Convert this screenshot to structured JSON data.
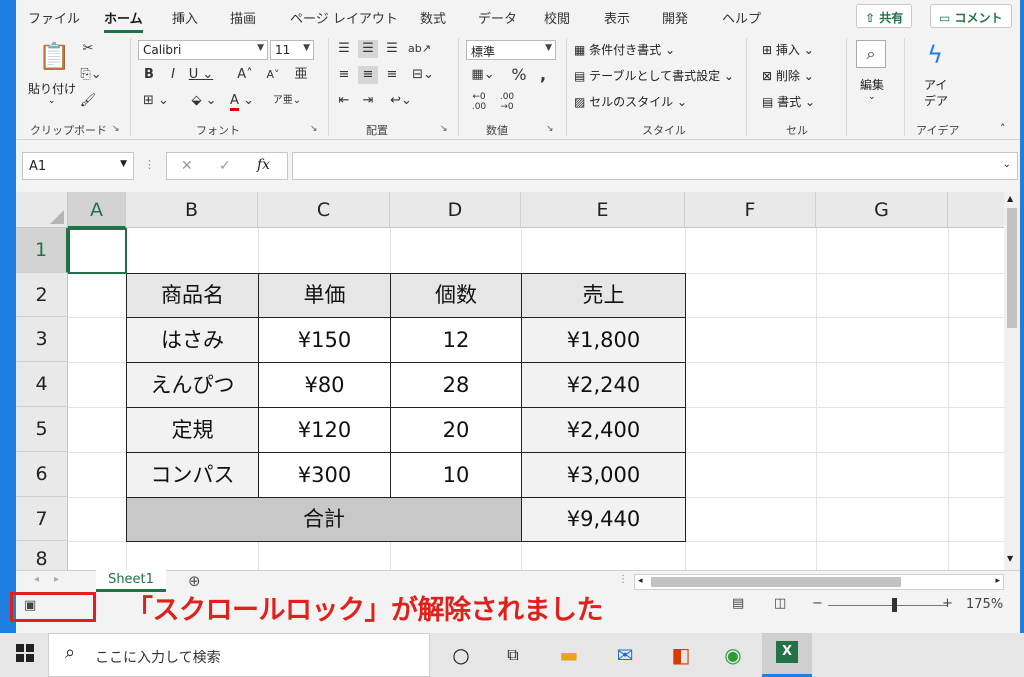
{
  "ribbon_tabs": [
    "ファイル",
    "ホーム",
    "挿入",
    "描画",
    "ページ レイアウト",
    "数式",
    "データ",
    "校閲",
    "表示",
    "開発",
    "ヘルプ"
  ],
  "top_buttons": {
    "share": "共有",
    "comment": "コメント"
  },
  "share_icon": "share-icon",
  "comment_icon": "comment-icon",
  "clipboard": {
    "paste": "貼り付け",
    "group": "クリップボード"
  },
  "font": {
    "name": "Calibri",
    "size": "11",
    "group": "フォント",
    "accent_color": "#e00000"
  },
  "alignment": {
    "group": "配置"
  },
  "number": {
    "format": "標準",
    "group": "数値"
  },
  "style": {
    "conditional": "条件付き書式",
    "table": "テーブルとして書式設定",
    "cell_style": "セルのスタイル",
    "group": "スタイル"
  },
  "cells": {
    "insert": "挿入",
    "delete": "削除",
    "format": "書式",
    "group": "セル"
  },
  "editing": {
    "label": "編集"
  },
  "ideas": {
    "label_line1": "アイ",
    "label_line2": "デア",
    "group": "アイデア"
  },
  "formula_bar": {
    "name_box": "A1",
    "cancel": "✕",
    "enter": "✓",
    "fx": "fx",
    "value": ""
  },
  "columns": [
    "A",
    "B",
    "C",
    "D",
    "E",
    "F",
    "G"
  ],
  "rows": [
    "1",
    "2",
    "3",
    "4",
    "5",
    "6",
    "7",
    "8"
  ],
  "table": {
    "headers": [
      "商品名",
      "単価",
      "個数",
      "売上"
    ],
    "rows": [
      [
        "はさみ",
        "¥150",
        "12",
        "¥1,800"
      ],
      [
        "えんぴつ",
        "¥80",
        "28",
        "¥2,240"
      ],
      [
        "定規",
        "¥120",
        "20",
        "¥2,400"
      ],
      [
        "コンパス",
        "¥300",
        "10",
        "¥3,000"
      ]
    ],
    "total_label": "合計",
    "total_value": "¥9,440"
  },
  "sheet_tab": "Sheet1",
  "add_sheet": "⊕",
  "annotation": "「スクロールロック」が解除されました",
  "zoom": "175%",
  "zoom_minus": "−",
  "zoom_plus": "+",
  "taskbar": {
    "search_placeholder": "ここに入力して検索"
  },
  "accent_green": "#217346",
  "annotation_red": "#e0201b"
}
